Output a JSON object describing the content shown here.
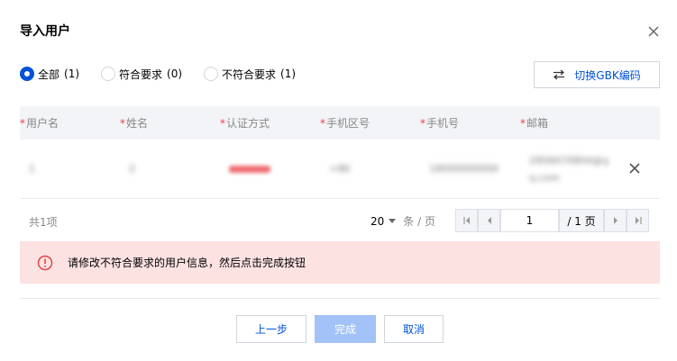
{
  "dialog": {
    "title": "导入用户"
  },
  "filters": [
    {
      "label": "全部",
      "count": "(1)",
      "selected": true
    },
    {
      "label": "符合要求",
      "count": "(0)",
      "selected": false
    },
    {
      "label": "不符合要求",
      "count": "(1)",
      "selected": false
    }
  ],
  "encode_button": {
    "label": "切换GBK编码"
  },
  "table": {
    "headers": [
      {
        "required": "*",
        "label": "用户名"
      },
      {
        "required": "*",
        "label": "姓名"
      },
      {
        "required": "*",
        "label": "认证方式"
      },
      {
        "required": "*",
        "label": "手机区号"
      },
      {
        "required": "*",
        "label": "手机号"
      },
      {
        "required": "*",
        "label": "邮箱"
      }
    ],
    "rows": [
      {
        "username": "1",
        "name": "2",
        "phone_code": "+86",
        "phone": "18000000000",
        "email_line1": "2958470804@q",
        "email_line2": "q.com"
      }
    ]
  },
  "pagination": {
    "total": "共1项",
    "page_size": "20",
    "page_unit": "条 / 页",
    "current_page": "1",
    "total_pages": "/ 1 页"
  },
  "alert": {
    "message": "请修改不符合要求的用户信息，然后点击完成按钮"
  },
  "footer": {
    "prev": "上一步",
    "finish": "完成",
    "cancel": "取消"
  },
  "colors": {
    "primary": "#0052d9",
    "primary_disabled": "#a3c2f8",
    "error": "#e54545",
    "alert_bg": "#fde2e2"
  }
}
